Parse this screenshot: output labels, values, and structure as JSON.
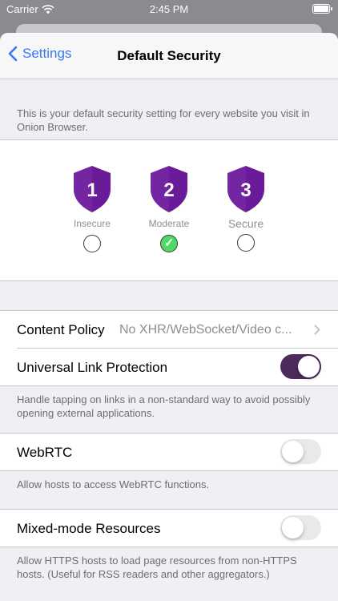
{
  "status_bar": {
    "carrier": "Carrier",
    "time": "2:45 PM"
  },
  "nav": {
    "back_label": "Settings",
    "title": "Default Security"
  },
  "intro_text": "This is your default security setting for every website you visit in Onion Browser.",
  "levels": [
    {
      "number": "1",
      "name": "Insecure",
      "selected": false
    },
    {
      "number": "2",
      "name": "Moderate",
      "selected": true
    },
    {
      "number": "3",
      "name": "Secure",
      "selected": false
    }
  ],
  "check_mark": "✓",
  "content_policy": {
    "label": "Content Policy",
    "value": "No XHR/WebSocket/Video c..."
  },
  "universal_link": {
    "label": "Universal Link Protection",
    "enabled": true,
    "footer": "Handle tapping on links in a non-standard way to avoid possibly opening external applications."
  },
  "webrtc": {
    "label": "WebRTC",
    "enabled": false,
    "footer": "Allow hosts to access WebRTC functions."
  },
  "mixed_mode": {
    "label": "Mixed-mode Resources",
    "enabled": false,
    "footer": "Allow HTTPS hosts to load page resources from non-HTTPS hosts. (Useful for RSS readers and other aggregators.)"
  },
  "colors": {
    "accent": "#3478f6",
    "shield_purple": "#6a1b9a",
    "toggle_on": "#4b2a5c",
    "check_green": "#4cd964"
  }
}
